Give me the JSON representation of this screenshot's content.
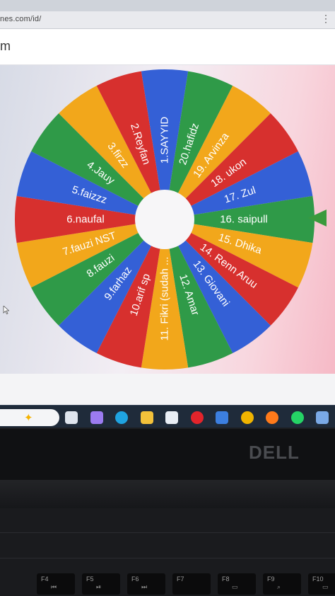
{
  "browser": {
    "url": "nes.com/id/",
    "menu_icon": "more-dots-icon"
  },
  "site": {
    "title": "m"
  },
  "wheel": {
    "colors": [
      "#3460d6",
      "#2f9a48",
      "#f2a71b",
      "#d7302e"
    ],
    "segments": [
      {
        "label": "1.SAYYID",
        "color": "#3460d6"
      },
      {
        "label": "20.hafidz",
        "color": "#2f9a48"
      },
      {
        "label": "19. Arvinza",
        "color": "#f2a71b"
      },
      {
        "label": "18. ukon",
        "color": "#d7302e"
      },
      {
        "label": "17. Zul",
        "color": "#3460d6"
      },
      {
        "label": "16. saipull",
        "color": "#2f9a48"
      },
      {
        "label": "15. Dhika",
        "color": "#f2a71b"
      },
      {
        "label": "14. Renn Aruu",
        "color": "#d7302e"
      },
      {
        "label": "13. Giovani",
        "color": "#3460d6"
      },
      {
        "label": "12. Amar",
        "color": "#2f9a48"
      },
      {
        "label": "11. Fikri (sudah ...",
        "color": "#f2a71b"
      },
      {
        "label": "10.arif sp",
        "color": "#d7302e"
      },
      {
        "label": "9.farhaz",
        "color": "#3460d6"
      },
      {
        "label": "8.fauzi",
        "color": "#2f9a48"
      },
      {
        "label": "7.fauzi NST",
        "color": "#f2a71b"
      },
      {
        "label": "6.naufal",
        "color": "#d7302e"
      },
      {
        "label": "5.faizzz",
        "color": "#3460d6"
      },
      {
        "label": "4.Jauy",
        "color": "#2f9a48"
      },
      {
        "label": "3.firzz",
        "color": "#f2a71b"
      },
      {
        "label": "2.Reyfan",
        "color": "#d7302e"
      }
    ],
    "pointer_color": "#3a9a3c"
  },
  "taskbar": {
    "icons": [
      {
        "name": "copilot-sparkle-icon",
        "color": "#f5b301"
      },
      {
        "name": "task-view-icon",
        "color": "#dfe5ee"
      },
      {
        "name": "copilot-icon",
        "color": "#9b7bf0"
      },
      {
        "name": "edge-icon",
        "color": "#1fa3e0"
      },
      {
        "name": "file-explorer-icon",
        "color": "#f3c13a"
      },
      {
        "name": "microsoft-store-icon",
        "color": "#e9eef5"
      },
      {
        "name": "opera-icon",
        "color": "#e3242b"
      },
      {
        "name": "mail-icon",
        "color": "#3c7fe0"
      },
      {
        "name": "chrome-icon",
        "color": "#f0b400"
      },
      {
        "name": "firefox-icon",
        "color": "#ff7a1a"
      },
      {
        "name": "whatsapp-icon",
        "color": "#25d366"
      },
      {
        "name": "app-icon",
        "color": "#7aa9e6"
      }
    ]
  },
  "laptop": {
    "brand": "DELL",
    "fkeys": [
      {
        "label": "F4",
        "symbol": "⏮"
      },
      {
        "label": "F5",
        "symbol": "⏯"
      },
      {
        "label": "F6",
        "symbol": "⏭"
      },
      {
        "label": "F7",
        "symbol": ""
      },
      {
        "label": "F8",
        "symbol": "▭"
      },
      {
        "label": "F9",
        "symbol": "⌕"
      },
      {
        "label": "F10",
        "symbol": "▭"
      }
    ]
  }
}
